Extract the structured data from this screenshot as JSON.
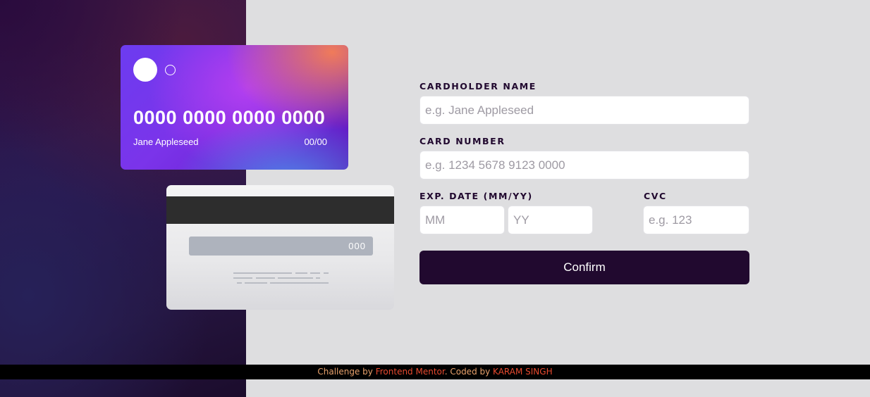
{
  "card": {
    "number": "0000 0000 0000 0000",
    "holder": "Jane Appleseed",
    "expiry": "00/00",
    "cvc": "000"
  },
  "form": {
    "name_label": "CARDHOLDER NAME",
    "name_placeholder": "e.g. Jane Appleseed",
    "number_label": "CARD NUMBER",
    "number_placeholder": "e.g. 1234 5678 9123 0000",
    "exp_label": "EXP. DATE (MM/YY)",
    "mm_placeholder": "MM",
    "yy_placeholder": "YY",
    "cvc_label": "CVC",
    "cvc_placeholder": "e.g. 123",
    "confirm_label": "Confirm"
  },
  "footer": {
    "prefix": "Challenge by ",
    "mentor_link": "Frontend Mentor",
    "middle": ". Coded by ",
    "author_link": "KARAM SINGH"
  },
  "colors": {
    "dark_violet": "#21092f",
    "accent": "#e84a2f"
  }
}
